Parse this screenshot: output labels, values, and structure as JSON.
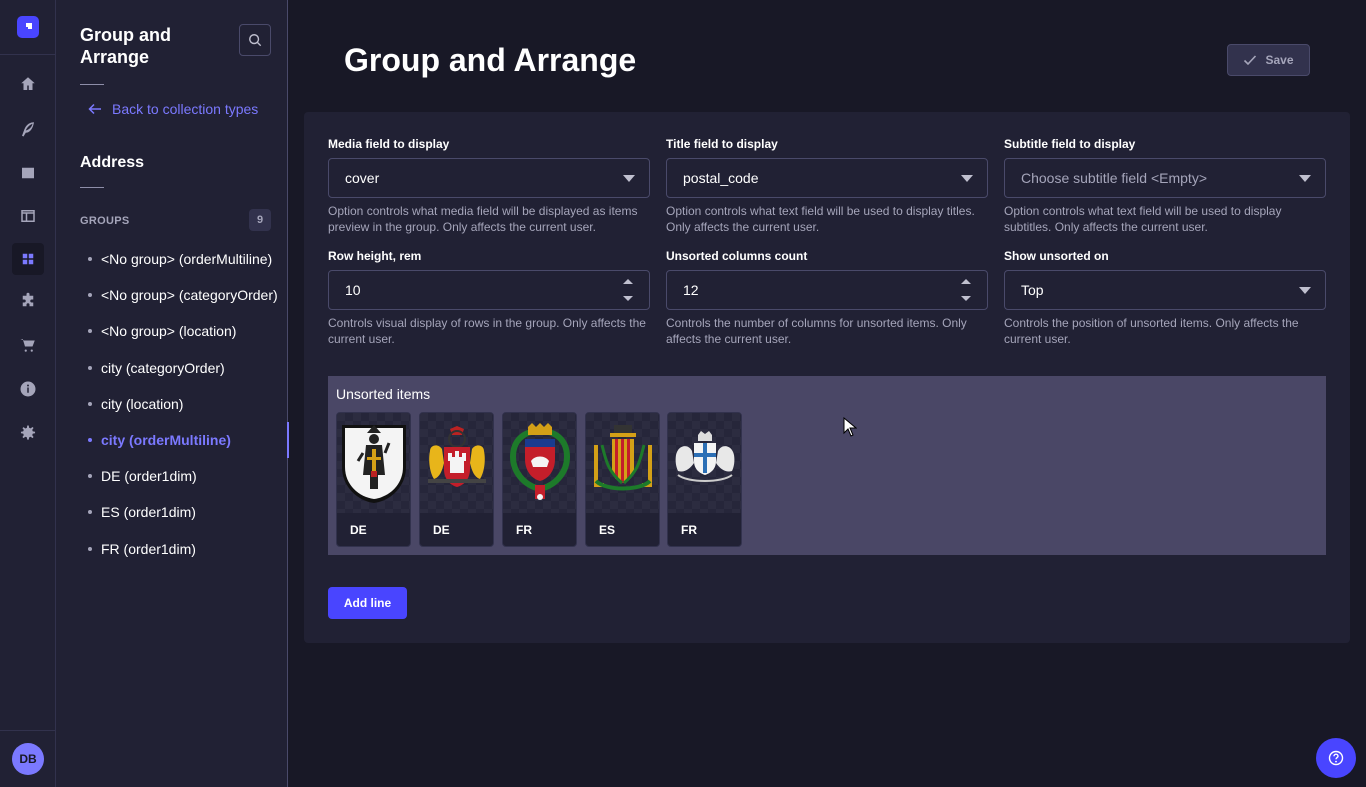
{
  "rail": {
    "items": [
      {
        "name": "home-icon"
      },
      {
        "name": "content-manager-icon"
      },
      {
        "name": "media-library-icon"
      },
      {
        "name": "layout-icon"
      },
      {
        "name": "group-and-arrange-icon",
        "active": true
      },
      {
        "name": "plugins-icon"
      },
      {
        "name": "marketplace-icon"
      },
      {
        "name": "info-icon"
      },
      {
        "name": "settings-icon"
      }
    ],
    "avatar_initials": "DB"
  },
  "subnav": {
    "title": "Group and Arrange",
    "back_link": "Back to collection types",
    "collection_name": "Address",
    "groups_label": "GROUPS",
    "groups_count": "9",
    "groups": [
      {
        "label": "<No group> (orderMultiline)",
        "active": false
      },
      {
        "label": "<No group> (categoryOrder)",
        "active": false
      },
      {
        "label": "<No group> (location)",
        "active": false
      },
      {
        "label": "city (categoryOrder)",
        "active": false
      },
      {
        "label": "city (location)",
        "active": false
      },
      {
        "label": "city (orderMultiline)",
        "active": true
      },
      {
        "label": "DE (order1dim)",
        "active": false
      },
      {
        "label": "ES (order1dim)",
        "active": false
      },
      {
        "label": "FR (order1dim)",
        "active": false
      }
    ]
  },
  "header": {
    "title": "Group and Arrange",
    "save_label": "Save"
  },
  "settings": {
    "media_field": {
      "label": "Media field to display",
      "value": "cover",
      "hint": "Option controls what media field will be displayed as items preview in the group. Only affects the current user."
    },
    "title_field": {
      "label": "Title field to display",
      "value": "postal_code",
      "hint": "Option controls what text field will be used to display titles. Only affects the current user."
    },
    "subtitle_field": {
      "label": "Subtitle field to display",
      "placeholder": "Choose subtitle field <Empty>",
      "hint": "Option controls what text field will be used to display subtitles. Only affects the current user."
    },
    "row_height": {
      "label": "Row height, rem",
      "value": "10",
      "hint": "Controls visual display of rows in the group. Only affects the current user."
    },
    "unsorted_columns": {
      "label": "Unsorted columns count",
      "value": "12",
      "hint": "Controls the number of columns for unsorted items. Only affects the current user."
    },
    "show_unsorted_on": {
      "label": "Show unsorted on",
      "value": "Top",
      "hint": "Controls the position of unsorted items. Only affects the current user."
    }
  },
  "unsorted": {
    "title": "Unsorted items",
    "cards": [
      {
        "label": "DE",
        "image": "munich-coat-of-arms"
      },
      {
        "label": "DE",
        "image": "hamburg-coat-of-arms"
      },
      {
        "label": "FR",
        "image": "paris-coat-of-arms"
      },
      {
        "label": "ES",
        "image": "valencia-coat-of-arms"
      },
      {
        "label": "FR",
        "image": "marseille-coat-of-arms"
      }
    ]
  },
  "actions": {
    "add_line_label": "Add line"
  },
  "colors": {
    "primary": "#4945ff",
    "primary_light": "#7b79ff",
    "background": "#181826",
    "surface": "#212134",
    "unsorted_bg": "#4a4766"
  }
}
